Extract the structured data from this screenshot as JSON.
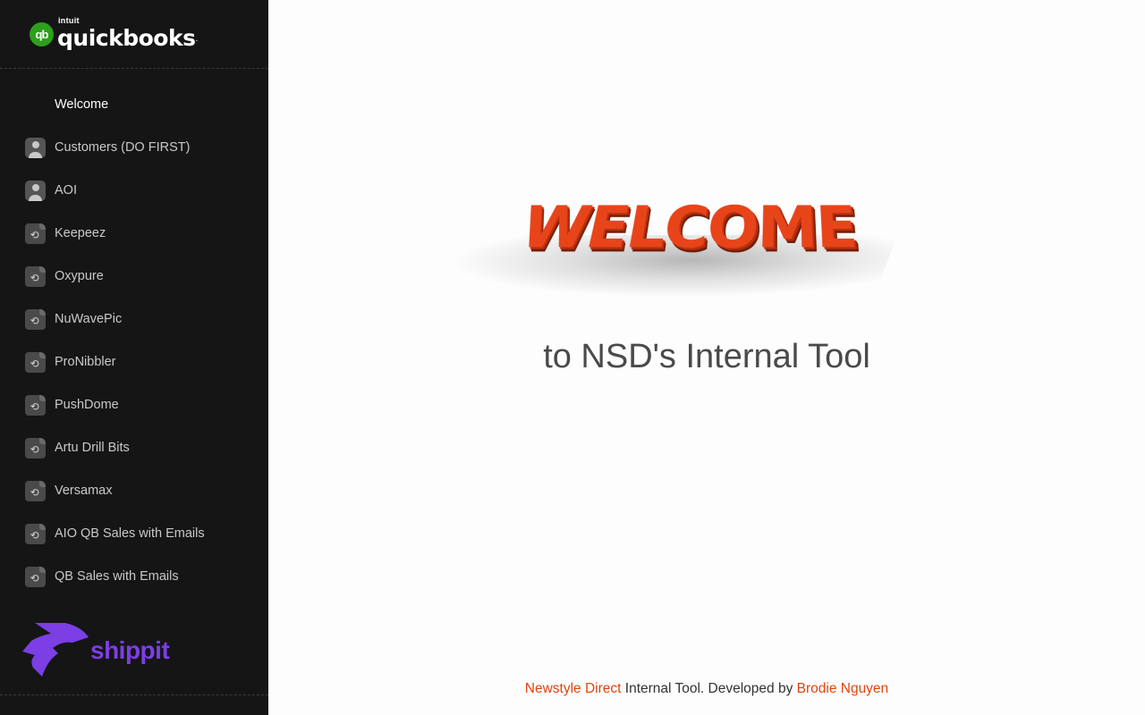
{
  "sidebar": {
    "brand": {
      "intuit": "intuit",
      "name": "quickbooks",
      "mark": "qb",
      "dot": "."
    },
    "items": [
      {
        "label": "Welcome",
        "icon": "grid-icon",
        "active": true
      },
      {
        "label": "Customers (DO FIRST)",
        "icon": "person-icon"
      },
      {
        "label": "AOI",
        "icon": "person-icon"
      },
      {
        "label": "Keepeez",
        "icon": "document-sync-icon"
      },
      {
        "label": "Oxypure",
        "icon": "document-sync-icon"
      },
      {
        "label": "NuWavePic",
        "icon": "document-sync-icon"
      },
      {
        "label": "ProNibbler",
        "icon": "document-sync-icon"
      },
      {
        "label": "PushDome",
        "icon": "document-sync-icon"
      },
      {
        "label": "Artu Drill Bits",
        "icon": "document-sync-icon"
      },
      {
        "label": "Versamax",
        "icon": "document-sync-icon"
      },
      {
        "label": "AIO QB Sales with Emails",
        "icon": "document-sync-icon"
      },
      {
        "label": "QB Sales with Emails",
        "icon": "document-sync-icon"
      }
    ],
    "partner_logo": {
      "text": "shippit",
      "color": "#7b3fe4"
    }
  },
  "main": {
    "welcome_word": "WELCOME",
    "subtitle": "to NSD's Internal Tool",
    "footer": {
      "company": "Newstyle Direct",
      "middle": " Internal Tool. Developed by ",
      "author": "Brodie Nguyen"
    }
  },
  "colors": {
    "sidebar_bg": "#151515",
    "accent": "#e0440e",
    "quickbooks_green": "#2ca01c",
    "shippit_purple": "#7b3fe4"
  }
}
